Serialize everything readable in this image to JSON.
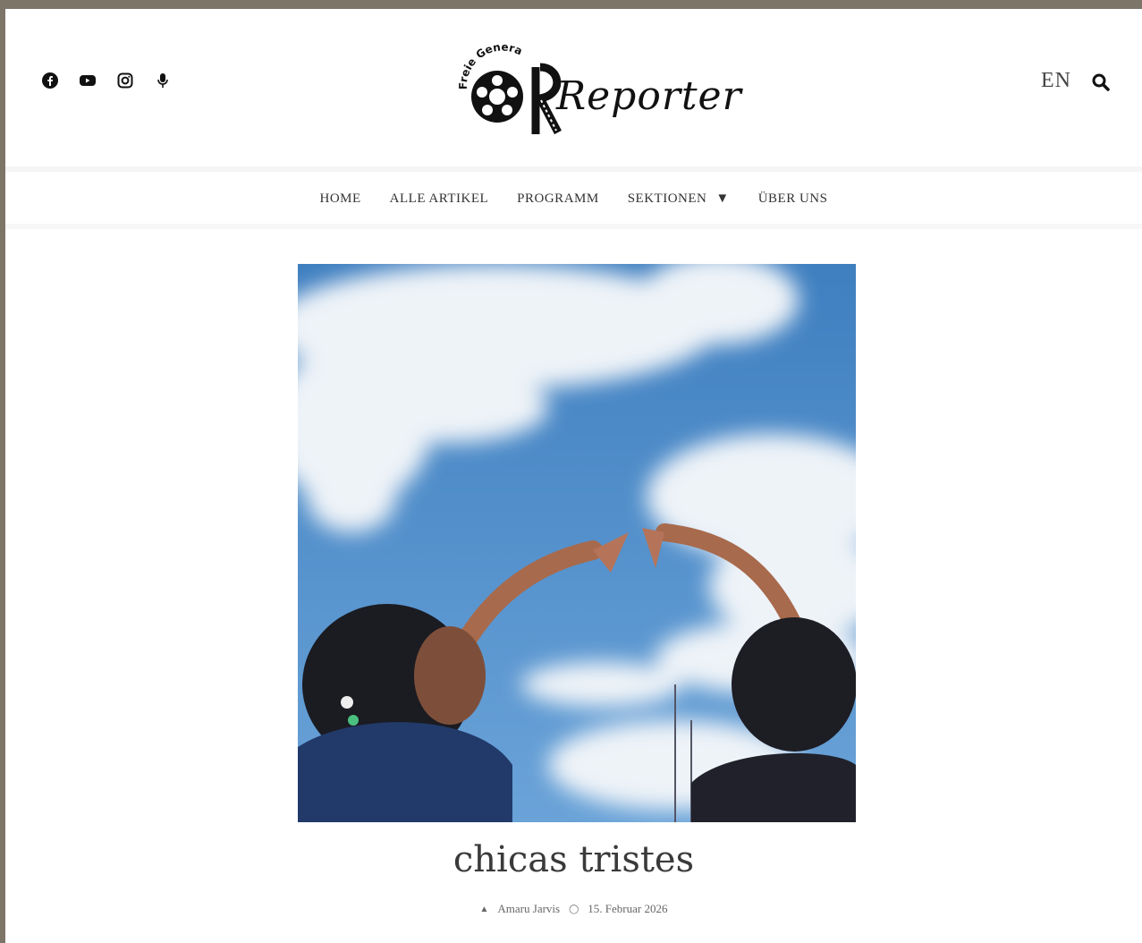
{
  "header": {
    "social_icons": [
      "facebook-icon",
      "youtube-icon",
      "instagram-icon",
      "microphone-icon"
    ],
    "logo": {
      "arc_text": "Freie Generation",
      "word": "Reporter"
    },
    "language": "EN"
  },
  "nav": {
    "items": [
      "HOME",
      "ALLE ARTIKEL",
      "PROGRAMM",
      "SEKTIONEN",
      "ÜBER UNS"
    ]
  },
  "article": {
    "title": "chicas tristes",
    "author": "Amaru Jarvis",
    "date": "15. Februar 2026"
  }
}
